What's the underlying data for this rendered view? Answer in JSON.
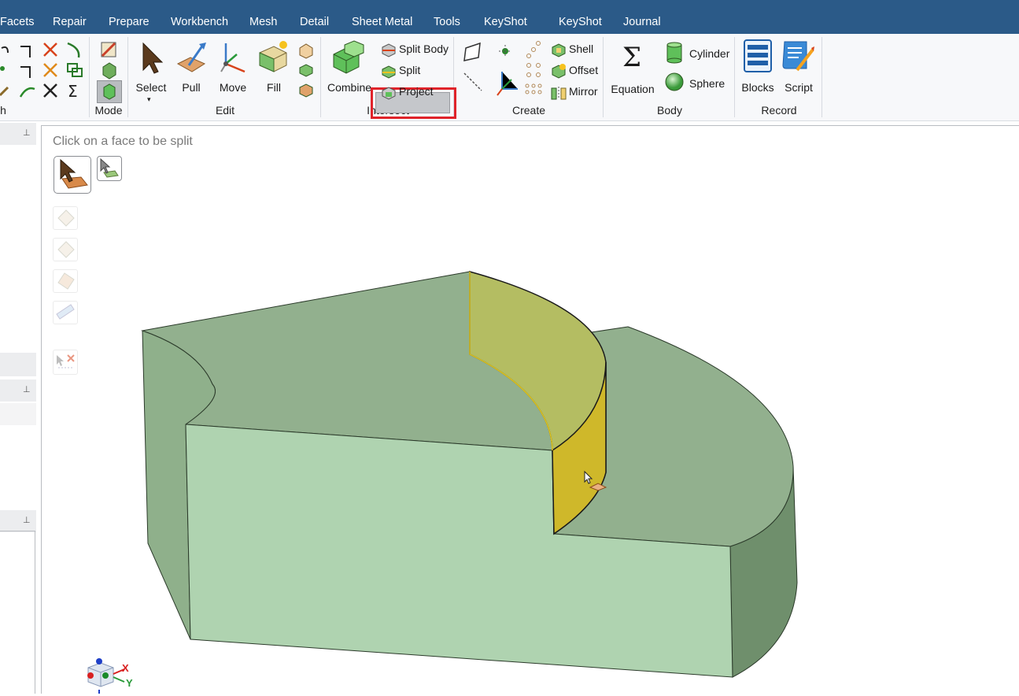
{
  "menubar": {
    "tabs": [
      "Facets",
      "Repair",
      "Prepare",
      "Workbench",
      "Mesh",
      "Detail",
      "Sheet Metal",
      "Tools",
      "KeyShot",
      "KeyShot",
      "Journal"
    ]
  },
  "ribbon": {
    "groups": {
      "partial": "h",
      "mode": "Mode",
      "edit": "Edit",
      "intersect": "Intersect",
      "create": "Create",
      "body": "Body",
      "record": "Record"
    },
    "edit": {
      "select": "Select",
      "pull": "Pull",
      "move": "Move",
      "fill": "Fill"
    },
    "intersect": {
      "combine": "Combine",
      "split_body": "Split Body",
      "split": "Split",
      "project": "Project"
    },
    "create": {
      "shell": "Shell",
      "offset": "Offset",
      "mirror": "Mirror"
    },
    "body": {
      "equation": "Equation",
      "cylinder": "Cylinder",
      "sphere": "Sphere"
    },
    "record": {
      "blocks": "Blocks",
      "script": "Script"
    }
  },
  "viewport": {
    "hint": "Click on a face to be split",
    "triad": {
      "x_label": "X",
      "y_label": "Y"
    }
  },
  "colors": {
    "menubar": "#2b5a88",
    "highlight_box": "#e0232a",
    "body_top": "#92b08e",
    "body_front": "#afd3b0",
    "split_face": "#b4bd62",
    "split_face_edge": "#ddc31f"
  }
}
